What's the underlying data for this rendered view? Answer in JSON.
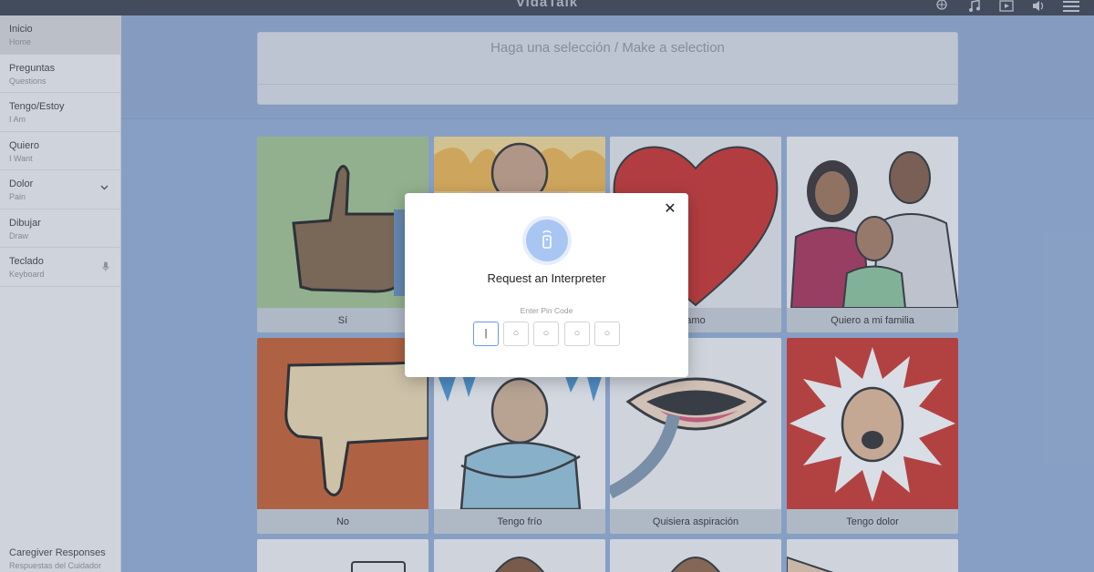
{
  "app": {
    "title": "VidaTalk"
  },
  "topbar_icons": [
    "translate-icon",
    "music-icon",
    "video-icon",
    "volume-icon",
    "menu-icon"
  ],
  "sidebar": {
    "items": [
      {
        "label": "Inicio",
        "sub": "Home",
        "active": true
      },
      {
        "label": "Preguntas",
        "sub": "Questions"
      },
      {
        "label": "Tengo/Estoy",
        "sub": "I Am"
      },
      {
        "label": "Quiero",
        "sub": "I Want"
      },
      {
        "label": "Dolor",
        "sub": "Pain",
        "expandable": true
      },
      {
        "label": "Dibujar",
        "sub": "Draw"
      },
      {
        "label": "Teclado",
        "sub": "Keyboard",
        "mic": true
      }
    ],
    "bottom": {
      "label": "Caregiver Responses",
      "sub": "Respuestas del Cuidador"
    }
  },
  "selection_bar": {
    "placeholder": "Haga una selección / Make a selection"
  },
  "cards": [
    {
      "caption": "Sí",
      "icon": "thumbs-up-picture"
    },
    {
      "caption": "",
      "icon": "hot-person-picture"
    },
    {
      "caption": "amo",
      "icon": "heart-picture"
    },
    {
      "caption": "Quiero a mi familia",
      "icon": "family-picture"
    },
    {
      "caption": "No",
      "icon": "thumbs-down-picture"
    },
    {
      "caption": "Tengo frío",
      "icon": "cold-person-picture"
    },
    {
      "caption": "Quisiera aspiración",
      "icon": "suction-picture"
    },
    {
      "caption": "Tengo dolor",
      "icon": "pain-face-picture"
    }
  ],
  "modal": {
    "title": "Request an Interpreter",
    "pin_label": "Enter Pin Code",
    "pin_slots": [
      "|",
      "○",
      "○",
      "○",
      "○"
    ],
    "close_symbol": "✕",
    "accent": "#a9c6f3"
  },
  "colors": {
    "topbar": "#2f3540",
    "main_bg": "#8ea8d0",
    "sidebar": "#f1f1f1"
  }
}
